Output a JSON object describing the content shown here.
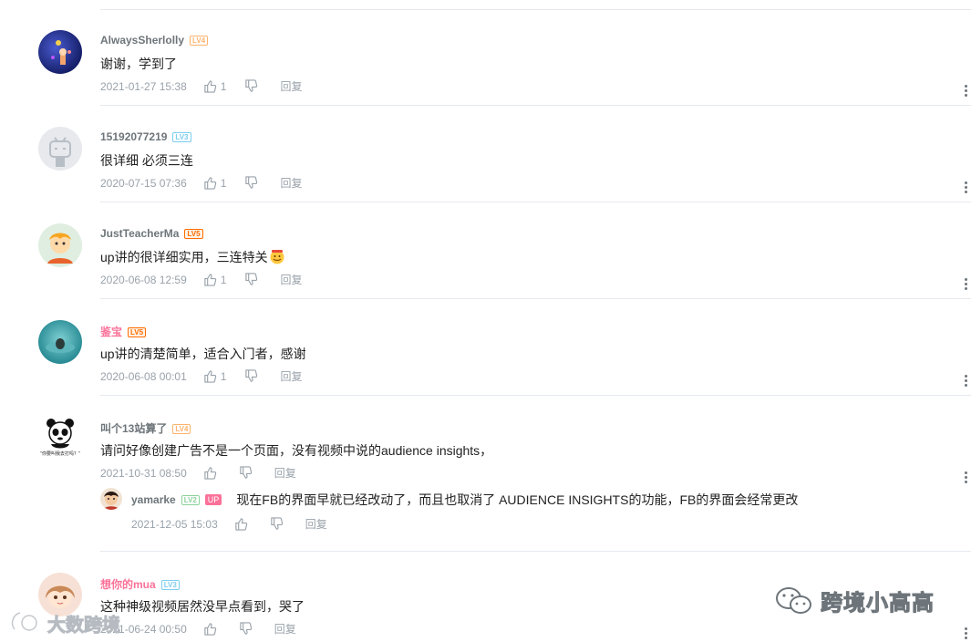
{
  "comments": [
    {
      "name": "AlwaysSherlolly",
      "level": "LV4",
      "text": "谢谢，学到了",
      "time": "2021-01-27 15:38",
      "likes": "1",
      "reply": "回复"
    },
    {
      "name": "15192077219",
      "level": "LV3",
      "text": "很详细 必须三连",
      "time": "2020-07-15 07:36",
      "likes": "1",
      "reply": "回复"
    },
    {
      "name": "JustTeacherMa",
      "level": "LV5",
      "text": "up讲的很详细实用，三连特关",
      "time": "2020-06-08 12:59",
      "likes": "1",
      "reply": "回复"
    },
    {
      "name": "鉴宝",
      "level": "LV5",
      "text": "up讲的清楚简单，适合入门者，感谢",
      "time": "2020-06-08 00:01",
      "likes": "1",
      "reply": "回复"
    },
    {
      "name": "叫个13站算了",
      "level": "LV4",
      "text": "请问好像创建广告不是一个页面，没有视频中说的audience insights，",
      "time": "2021-10-31 08:50",
      "likes": "",
      "reply": "回复"
    },
    {
      "name": "想你的mua",
      "level": "LV3",
      "text": "这种神级视频居然没早点看到，哭了",
      "time": "2021-06-24 00:50",
      "likes": "",
      "reply": "回复"
    }
  ],
  "sub_reply": {
    "name": "yamarke",
    "level": "LV2",
    "badge": "UP",
    "text": "现在FB的界面早就已经改动了，而且也取消了 AUDIENCE INSIGHTS的功能，FB的界面会经常更改",
    "time": "2021-12-05 15:03",
    "reply": "回复"
  },
  "panda_caption": "\"你要叫我去打吗？\"",
  "watermark": {
    "wechat": "跨境小高高",
    "bottom": "大数跨境"
  }
}
